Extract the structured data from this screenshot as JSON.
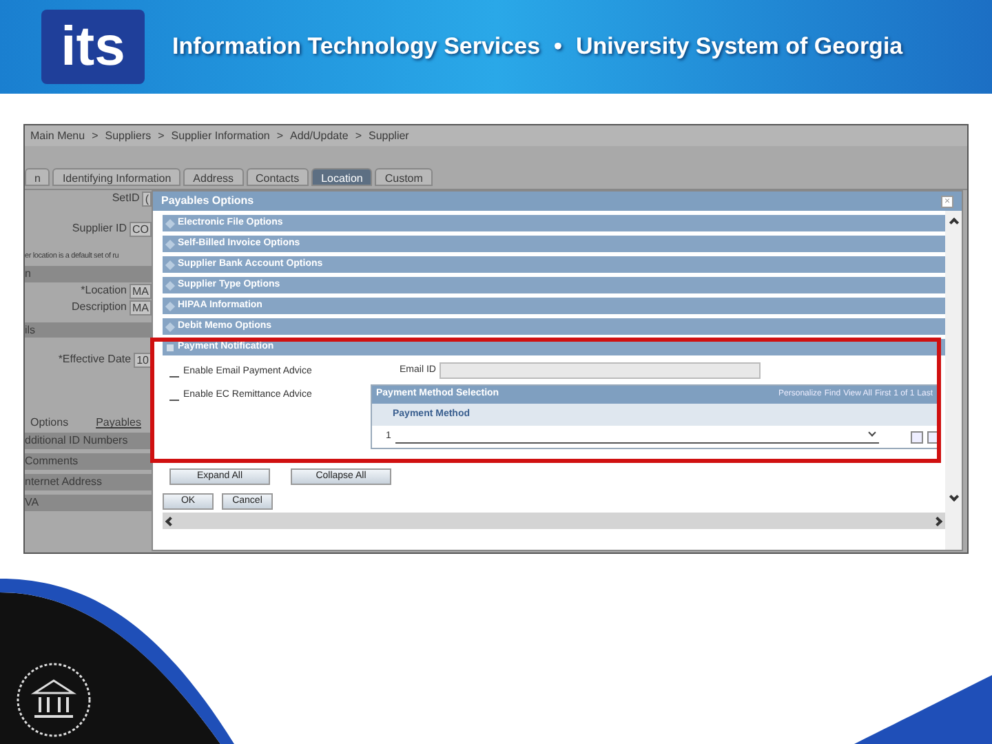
{
  "banner": {
    "logo": "its",
    "title": "Information Technology Services",
    "separator": "•",
    "subtitle": "University System of Georgia"
  },
  "screenshot": {
    "breadcrumb": [
      {
        "label": "Main Menu"
      },
      {
        "label": "Suppliers",
        "separator": ">"
      },
      {
        "label": "Supplier Information",
        "separator": ">"
      },
      {
        "label": "Add/Update",
        "separator": ">"
      },
      {
        "label": "Supplier",
        "separator": ">"
      }
    ],
    "tabs": [
      {
        "label": "n",
        "selected": false
      },
      {
        "label": "Identifying Information",
        "selected": false
      },
      {
        "label": "Address",
        "selected": false
      },
      {
        "label": "Contacts",
        "selected": false
      },
      {
        "label": "Location",
        "selected": true
      },
      {
        "label": "Custom",
        "selected": false
      }
    ],
    "top_fields": [
      {
        "label": "SetID",
        "value": "("
      },
      {
        "label": "Supplier ID",
        "value": "CO"
      }
    ],
    "note": "er location is a default set of ru",
    "bar_1": "n",
    "mid_fields": [
      {
        "label": "*Location",
        "value": "MA"
      },
      {
        "label": "Description",
        "value": "MA"
      }
    ],
    "bar_2": "ils",
    "date_field": {
      "label": "*Effective Date",
      "value": "10"
    },
    "sub_tabs": [
      {
        "label": "Options",
        "kind": "text"
      },
      {
        "label": "Payables",
        "kind": "link"
      }
    ],
    "side_sections": [
      "dditional ID Numbers",
      "Comments",
      "nternet Address",
      "VA"
    ],
    "modal": {
      "title": "Payables Options",
      "close": "×",
      "sections": [
        {
          "label": "Electronic File Options",
          "expanded": false
        },
        {
          "label": "Self-Billed Invoice Options",
          "expanded": false
        },
        {
          "label": "Supplier Bank Account Options",
          "expanded": false
        },
        {
          "label": "Supplier Type Options",
          "expanded": false
        },
        {
          "label": "HIPAA Information",
          "expanded": false
        },
        {
          "label": "Debit Memo Options",
          "expanded": false
        },
        {
          "label": "Payment Notification",
          "expanded": true
        }
      ],
      "checkboxes": [
        {
          "label": "Enable Email Payment Advice",
          "checked": false
        },
        {
          "label": "Enable EC Remittance Advice",
          "checked": false
        }
      ],
      "email_field": {
        "label": "Email ID"
      },
      "grid": {
        "title": "Payment Method Selection",
        "nav": [
          "Personalize",
          "Find",
          "View All",
          "First",
          "1 of 1",
          "Last"
        ],
        "columns": [
          "Payment Method"
        ],
        "rows": [
          {
            "number": "1"
          }
        ]
      },
      "expand_buttons": [
        "Expand All",
        "Collapse All"
      ],
      "actions": [
        "OK",
        "Cancel"
      ]
    }
  }
}
